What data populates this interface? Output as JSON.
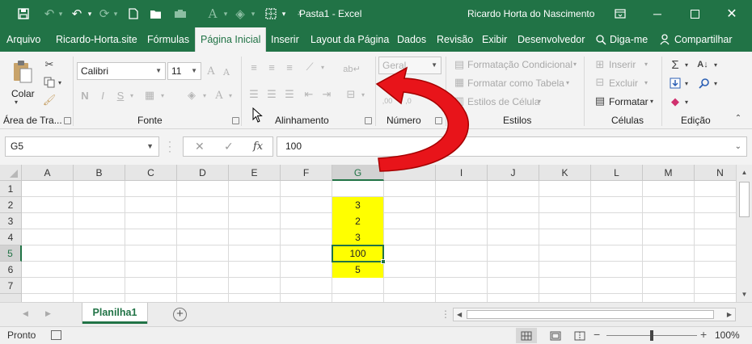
{
  "colors": {
    "accent": "#217346",
    "highlight_fill": "#ffff00",
    "arrow": "#e8141a"
  },
  "window": {
    "title": "Pasta1  -  Excel",
    "user": "Ricardo Horta do Nascimento"
  },
  "tabs": [
    {
      "label": "Arquivo"
    },
    {
      "label": "Ricardo-Horta.site"
    },
    {
      "label": "Fórmulas"
    },
    {
      "label": "Página Inicial"
    },
    {
      "label": "Inserir"
    },
    {
      "label": "Layout da Página"
    },
    {
      "label": "Dados"
    },
    {
      "label": "Revisão"
    },
    {
      "label": "Exibir"
    },
    {
      "label": "Desenvolvedor"
    },
    {
      "label": "Diga-me"
    },
    {
      "label": "Compartilhar"
    }
  ],
  "ribbon": {
    "clipboard": {
      "paste_label": "Colar",
      "group_label": "Área de Tra..."
    },
    "font": {
      "font_name": "Calibri",
      "font_size": "11",
      "bold": "N",
      "italic": "I",
      "underline": "S",
      "group_label": "Fonte"
    },
    "alignment": {
      "group_label": "Alinhamento"
    },
    "number": {
      "format": "Geral",
      "group_label": "Número"
    },
    "styles": {
      "conditional": "Formatação Condicional",
      "as_table": "Formatar como Tabela",
      "cell_styles": "Estilos de Célula",
      "group_label": "Estilos"
    },
    "cells": {
      "insert": "Inserir",
      "delete": "Excluir",
      "format": "Formatar",
      "group_label": "Células"
    },
    "editing": {
      "group_label": "Edição"
    }
  },
  "formula_bar": {
    "name_box": "G5",
    "fx_label": "fx",
    "formula": "100"
  },
  "grid": {
    "columns": [
      "A",
      "B",
      "C",
      "D",
      "E",
      "F",
      "G",
      "I",
      "J",
      "K",
      "L",
      "M",
      "N"
    ],
    "rows": [
      "1",
      "2",
      "3",
      "4",
      "5",
      "6",
      "7"
    ],
    "selected_column": "G",
    "selected_row": "5",
    "highlight_column": "G",
    "cells_G": [
      "",
      "3",
      "2",
      "3",
      "100",
      "5",
      ""
    ]
  },
  "sheets": {
    "active": "Planilha1"
  },
  "status": {
    "ready": "Pronto",
    "zoom": "100%",
    "zoom_level": 1.0
  }
}
